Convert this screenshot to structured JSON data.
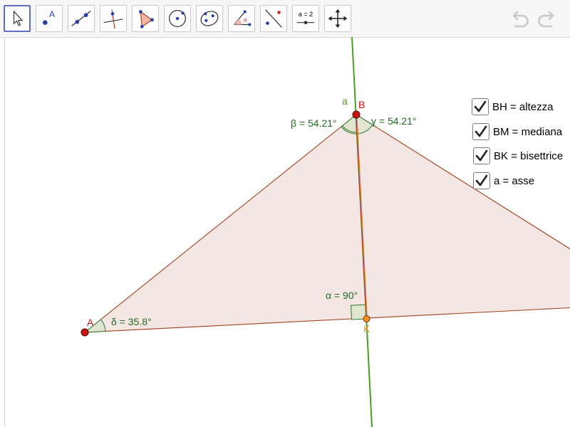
{
  "toolbar": {
    "tools": [
      {
        "name": "move-tool",
        "icon": "cursor-arrow-icon",
        "active": true
      },
      {
        "name": "point-tool",
        "icon": "point-icon",
        "label": "A"
      },
      {
        "name": "line-tool",
        "icon": "line-through-points-icon"
      },
      {
        "name": "perpendicular-line-tool",
        "icon": "perpendicular-line-icon"
      },
      {
        "name": "polygon-tool",
        "icon": "polygon-icon"
      },
      {
        "name": "circle-tool",
        "icon": "circle-center-point-icon"
      },
      {
        "name": "ellipse-tool",
        "icon": "ellipse-icon"
      },
      {
        "name": "angle-tool",
        "icon": "angle-icon",
        "label": "α"
      },
      {
        "name": "reflect-tool",
        "icon": "reflect-about-line-icon"
      },
      {
        "name": "slider-tool",
        "icon": "slider-icon",
        "label": "a = 2"
      },
      {
        "name": "move-graphics-tool",
        "icon": "move-arrows-icon"
      }
    ],
    "undo_icon": "undo-icon",
    "redo_icon": "redo-icon"
  },
  "construction": {
    "points": {
      "A": "A",
      "B": "B",
      "K": "K"
    },
    "line_label": "a",
    "angles": {
      "beta": "β = 54.21°",
      "gamma": "γ = 54.21°",
      "alpha": "α = 90°",
      "delta": "δ = 35.8°"
    }
  },
  "checkboxes": [
    {
      "label": "BH = altezza",
      "checked": true
    },
    {
      "label": "BM = mediana",
      "checked": true
    },
    {
      "label": "BK = bisettrice",
      "checked": true
    },
    {
      "label": "a = asse",
      "checked": true
    }
  ],
  "colors": {
    "triangle_fill": "#f3e5e1",
    "triangle_edge": "#a0401c",
    "axis_line": "#3e9a1e",
    "point_red": "#cc1111",
    "point_orange": "#ff8c1a",
    "angle_text": "#1f6b1f",
    "point_label": "#cc1111"
  }
}
